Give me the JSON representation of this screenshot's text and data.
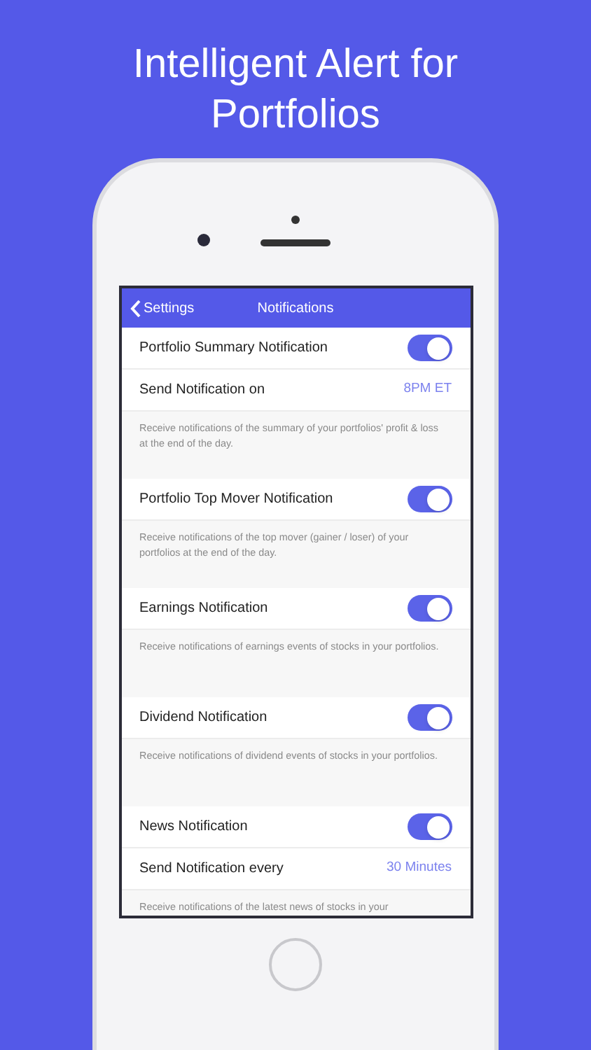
{
  "headline": "Intelligent Alert for Portfolios",
  "nav": {
    "back": "Settings",
    "title": "Notifications"
  },
  "sections": [
    {
      "items": [
        {
          "kind": "toggle",
          "label": "Portfolio Summary Notification",
          "on": true
        },
        {
          "kind": "value",
          "label": "Send Notification on",
          "value": "8PM ET"
        }
      ],
      "footer": "Receive notifications of the summary of your portfolios' profit & loss at the end of the day."
    },
    {
      "items": [
        {
          "kind": "toggle",
          "label": "Portfolio Top Mover Notification",
          "on": true
        }
      ],
      "footer": "Receive notifications of the top mover (gainer / loser) of your portfolios at the end of the day."
    },
    {
      "items": [
        {
          "kind": "toggle",
          "label": "Earnings Notification",
          "on": true
        }
      ],
      "footer": "Receive notifications of earnings events of stocks in your portfolios."
    },
    {
      "items": [
        {
          "kind": "toggle",
          "label": "Dividend Notification",
          "on": true
        }
      ],
      "footer": "Receive notifications of dividend events of stocks in your portfolios."
    },
    {
      "items": [
        {
          "kind": "toggle",
          "label": "News Notification",
          "on": true
        },
        {
          "kind": "value",
          "label": "Send Notification every",
          "value": "30 Minutes"
        }
      ],
      "footer": "Receive notifications of the latest news of stocks in your"
    }
  ]
}
